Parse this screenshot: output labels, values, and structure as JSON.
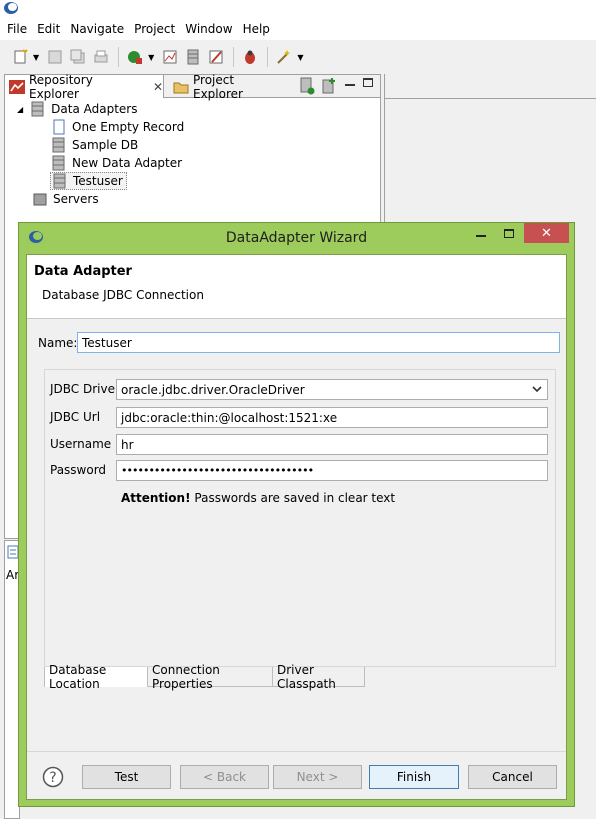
{
  "menubar": {
    "items": [
      "File",
      "Edit",
      "Navigate",
      "Project",
      "Window",
      "Help"
    ]
  },
  "views": {
    "repository_tab": "Repository Explorer",
    "project_tab": "Project Explorer",
    "partial_label": "Ar"
  },
  "tree": {
    "data_adapters": "Data Adapters",
    "children": [
      "One Empty Record",
      "Sample DB",
      "New Data Adapter",
      "Testuser"
    ],
    "servers": "Servers"
  },
  "dialog": {
    "title": "DataAdapter Wizard",
    "header_title": "Data Adapter",
    "header_subtitle": "Database JDBC Connection",
    "name_label": "Name:",
    "name_value": "Testuser",
    "fields": {
      "driver_label": "JDBC Driver",
      "driver_value": "oracle.jdbc.driver.OracleDriver",
      "url_label": "JDBC Url",
      "url_value": "jdbc:oracle:thin:@localhost:1521:xe",
      "username_label": "Username",
      "username_value": "hr",
      "password_label": "Password",
      "password_value": "•••••••••••••••••••••••••••••••••••"
    },
    "attention_bold": "Attention!",
    "attention_text": "Passwords are saved in clear text",
    "tabs": [
      "Database Location",
      "Connection Properties",
      "Driver Classpath"
    ],
    "buttons": {
      "test": "Test",
      "back": "< Back",
      "next": "Next >",
      "finish": "Finish",
      "cancel": "Cancel"
    }
  },
  "colors": {
    "dialog_frame": "#9dcc5c",
    "close_button": "#c75050",
    "input_border": "#abadb3",
    "name_focus_border": "#7eb4ea"
  }
}
